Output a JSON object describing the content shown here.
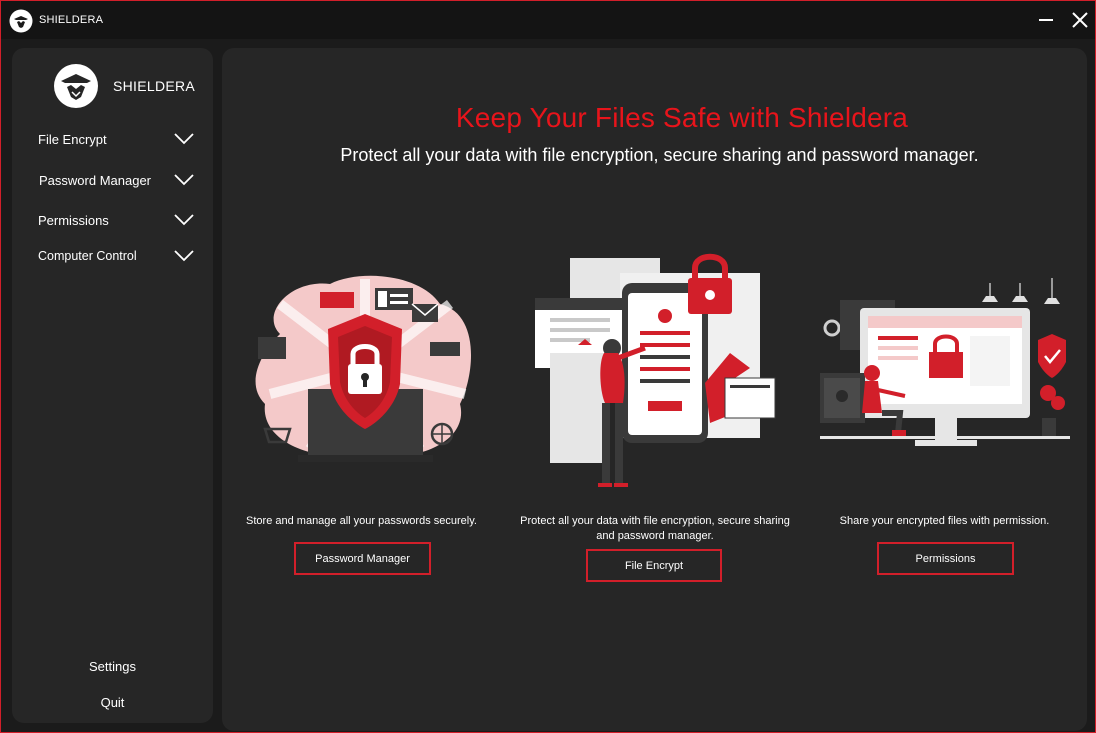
{
  "window": {
    "title": "SHIELDERA",
    "minimize_icon": "minimize-icon",
    "close_icon": "close-icon"
  },
  "sidebar": {
    "brand": "SHIELDERA",
    "items": [
      {
        "label": "File Encrypt",
        "icon": "chevron-down-icon"
      },
      {
        "label": "Password Manager",
        "icon": "chevron-down-icon"
      },
      {
        "label": "Permissions",
        "icon": "chevron-down-icon"
      },
      {
        "label": "Computer Control",
        "icon": "chevron-down-icon"
      }
    ],
    "settings_label": "Settings",
    "quit_label": "Quit"
  },
  "main": {
    "headline": "Keep Your Files Safe with Shieldera",
    "subheadline": "Protect all your data with file encryption, secure sharing and password manager.",
    "cards": [
      {
        "description": "Store and manage all your passwords securely.",
        "button_label": "Password Manager",
        "illustration": "shield-laptop-illustration"
      },
      {
        "description": "Protect all your data with file encryption, secure sharing and password manager.",
        "button_label": "File Encrypt",
        "illustration": "phone-lock-illustration"
      },
      {
        "description": "Share your encrypted files with permission.",
        "button_label": "Permissions",
        "illustration": "monitor-lock-illustration"
      }
    ]
  },
  "colors": {
    "accent": "#e8141b",
    "border_red": "#d21f2a",
    "panel": "#262626",
    "background": "#1b1b1b"
  }
}
